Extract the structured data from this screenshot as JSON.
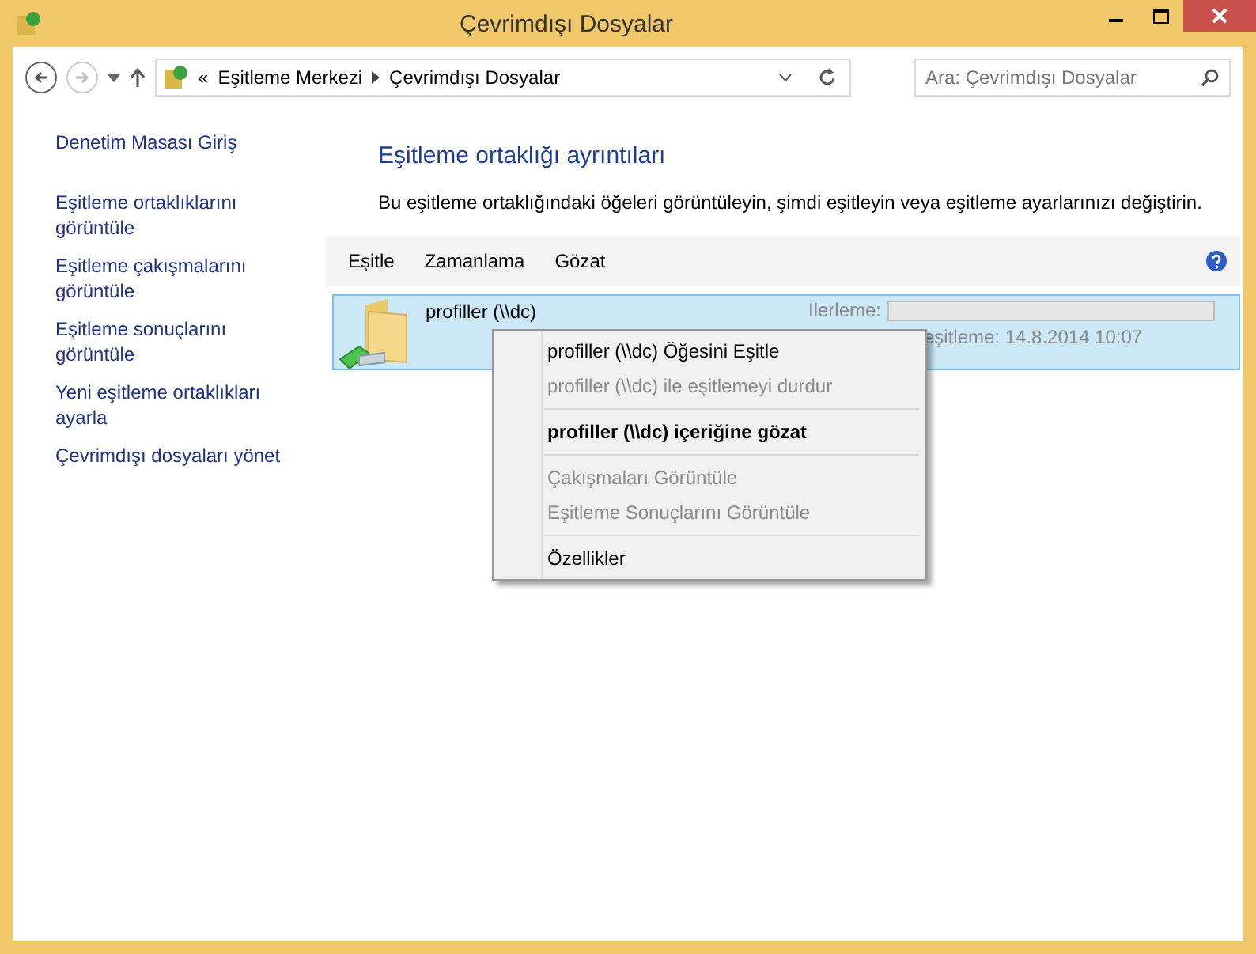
{
  "window": {
    "title": "Çevrimdışı Dosyalar"
  },
  "address_bar": {
    "overflow": "«",
    "crumbs": [
      "Eşitleme Merkezi",
      "Çevrimdışı Dosyalar"
    ]
  },
  "search": {
    "placeholder": "Ara: Çevrimdışı Dosyalar"
  },
  "sidebar": {
    "items": [
      "Denetim Masası Giriş",
      "Eşitleme ortaklıklarını görüntüle",
      "Eşitleme çakışmalarını görüntüle",
      "Eşitleme sonuçlarını görüntüle",
      "Yeni eşitleme ortaklıkları ayarla",
      "Çevrimdışı dosyaları yönet"
    ]
  },
  "heading": "Eşitleme ortaklığı ayrıntıları",
  "description": "Bu eşitleme ortaklığındaki öğeleri görüntüleyin, şimdi eşitleyin veya eşitleme ayarlarınızı değiştirin.",
  "toolbar": [
    "Eşitle",
    "Zamanlama",
    "Gözat"
  ],
  "items": [
    {
      "name": "profiller (\\\\dc)",
      "selected": true,
      "progress_label": "İlerleme:",
      "level": 0,
      "status": "eşitleme: 14.8.2014 10:07"
    }
  ],
  "context_menu": [
    {
      "kind": "item",
      "label": "profiller (\\\\dc) Öğesini Eşitle",
      "disabled": false,
      "default": false
    },
    {
      "kind": "item",
      "label": "profiller (\\\\dc) ile eşitlemeyi durdur",
      "disabled": true,
      "default": false
    },
    {
      "kind": "separator"
    },
    {
      "kind": "item",
      "label": "profiller (\\\\dc) içeriğine gözat",
      "disabled": false,
      "default": true
    },
    {
      "kind": "separator"
    },
    {
      "kind": "item",
      "label": "Çakışmaları Görüntüle",
      "disabled": true,
      "default": false
    },
    {
      "kind": "item",
      "label": "Eşitleme Sonuçlarını Görüntüle",
      "disabled": true,
      "default": false
    },
    {
      "kind": "separator"
    },
    {
      "kind": "item",
      "label": "Özellikler",
      "disabled": false,
      "default": false
    }
  ]
}
